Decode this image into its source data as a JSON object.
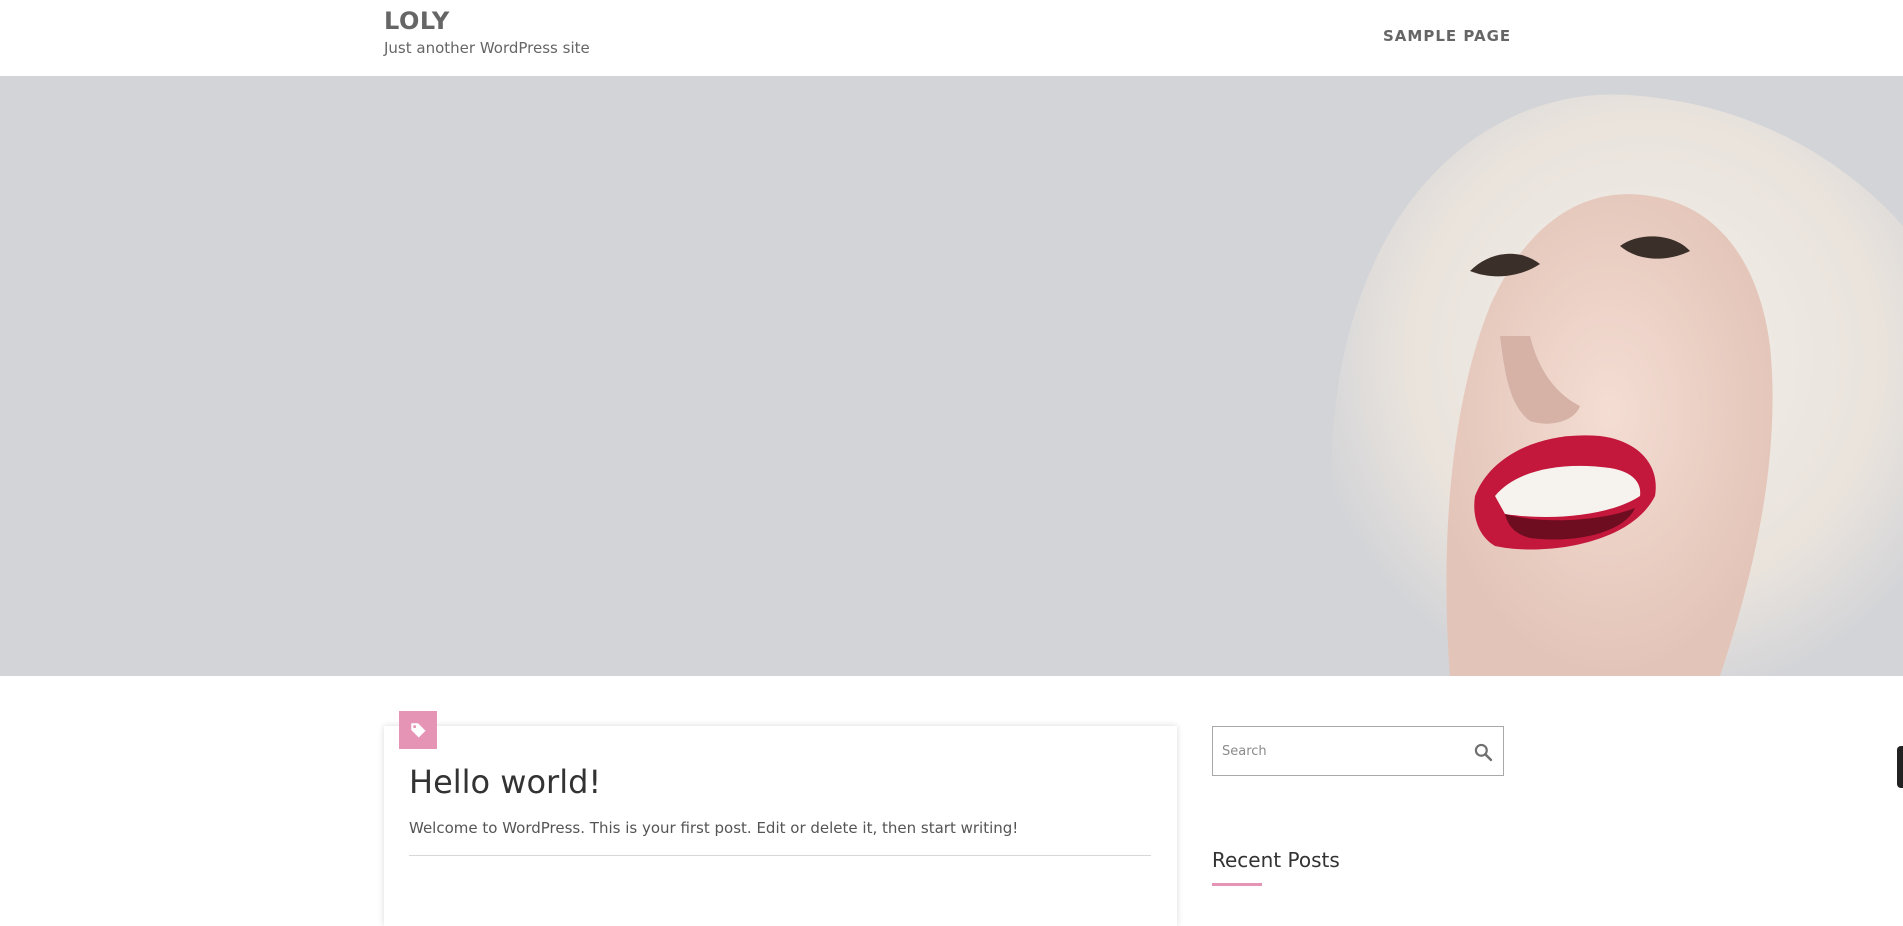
{
  "header": {
    "site_title": "LOLY",
    "tagline": "Just another WordPress site",
    "nav": [
      {
        "label": "SAMPLE PAGE"
      }
    ]
  },
  "hero": {
    "image_alt": "woman in white fur hood laughing",
    "background_color": "#d3d4d8"
  },
  "post": {
    "category_icon": "tag-icon",
    "title": "Hello world!",
    "excerpt": "Welcome to WordPress. This is your first post. Edit or delete it, then start writing!"
  },
  "sidebar": {
    "search": {
      "placeholder": "Search",
      "icon": "search-icon"
    },
    "recent_posts_title": "Recent Posts"
  },
  "colors": {
    "accent": "#e694b6",
    "text_muted": "#666666",
    "heading": "#333333"
  }
}
